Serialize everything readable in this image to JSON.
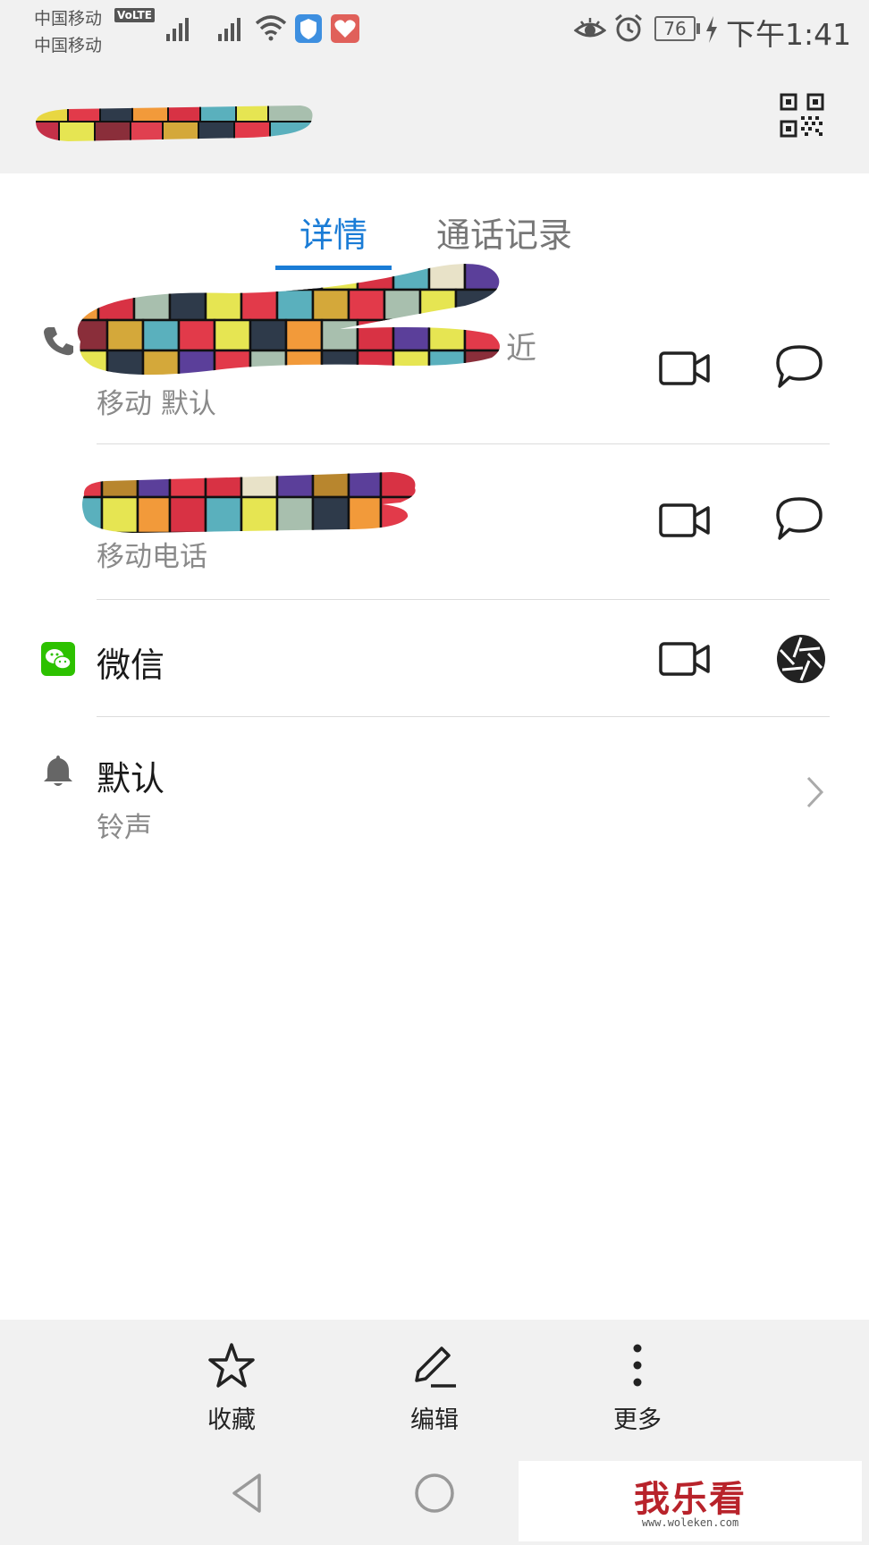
{
  "status_bar": {
    "carrier_1": "中国移动",
    "volte_badge": "VoLTE",
    "carrier_2": "中国移动",
    "battery": "76",
    "time": "下午1:41"
  },
  "tabs": [
    {
      "label": "详情",
      "active": true
    },
    {
      "label": "通话记录",
      "active": false
    }
  ],
  "rows": {
    "phone_1": {
      "partial_text": "近",
      "sub": "移动 默认"
    },
    "phone_2": {
      "sub": "移动电话"
    },
    "wechat": {
      "label": "微信"
    },
    "ringtone": {
      "label": "默认",
      "sub": "铃声"
    }
  },
  "bottom_actions": [
    {
      "label": "收藏",
      "icon": "star-icon"
    },
    {
      "label": "编辑",
      "icon": "pencil-icon"
    },
    {
      "label": "更多",
      "icon": "more-vertical-icon"
    }
  ],
  "watermark": {
    "brand": "我乐看",
    "url": "www.woleken.com"
  },
  "colors": {
    "accent": "#1a7cd6",
    "wechat_green": "#2dc100"
  }
}
